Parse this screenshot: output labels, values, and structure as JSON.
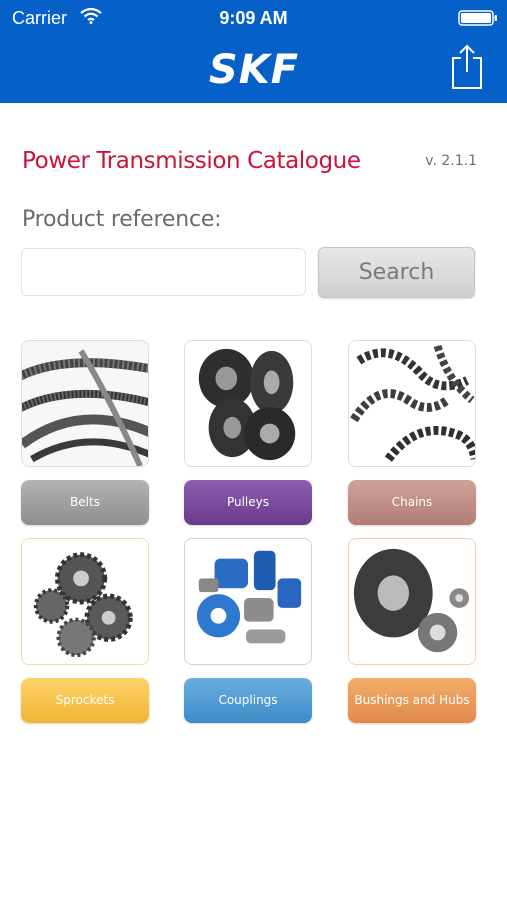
{
  "status_bar": {
    "carrier": "Carrier",
    "time": "9:09 AM"
  },
  "header": {
    "brand": "SKF",
    "brand_color": "#0561c8"
  },
  "title": "Power Transmission Catalogue",
  "version": "v. 2.1.1",
  "product_reference_label": "Product reference:",
  "search": {
    "value": "",
    "placeholder": "",
    "button_label": "Search"
  },
  "categories": [
    {
      "label": "Belts",
      "color": "#9e9e9e"
    },
    {
      "label": "Pulleys",
      "color": "#7b4a9e"
    },
    {
      "label": "Chains",
      "color": "#bf8f86"
    },
    {
      "label": "Sprockets",
      "color": "#f2c14b"
    },
    {
      "label": "Couplings",
      "color": "#4f9bd4"
    },
    {
      "label": "Bushings and Hubs",
      "color": "#e99a57"
    }
  ],
  "icons": [
    "wifi-icon",
    "battery-icon",
    "share-icon"
  ]
}
